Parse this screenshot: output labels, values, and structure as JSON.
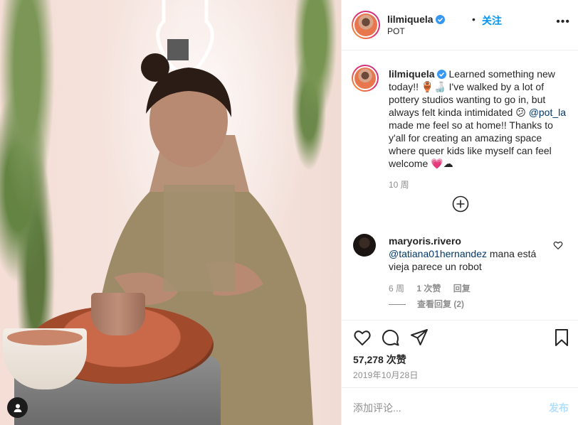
{
  "header": {
    "username": "lilmiquela",
    "dot": "•",
    "follow_label": "关注",
    "location": "POT",
    "more_label": "•••"
  },
  "caption": {
    "username": "lilmiquela",
    "text_1": "Learned something new today!! 🏺🍶 I've walked by a lot of pottery studios wanting to go in, but always felt kinda intimidated 😕 ",
    "mention": "@pot_la",
    "text_2": " made me feel so at home!! Thanks to y'all for creating an amazing space where queer kids like myself can feel welcome 💗☁",
    "time": "10 周"
  },
  "comment": {
    "username": "maryoris.rivero",
    "mention": "@tatiana01hernandez",
    "text": " mana está vieja parece un robot",
    "time": "6 周",
    "likes": "1 次赞",
    "reply_label": "回复",
    "view_replies": "查看回复 (2)"
  },
  "actions": {
    "likes": "57,278 次赞",
    "date": "2019年10月28日"
  },
  "comment_box": {
    "placeholder": "添加评论...",
    "post_label": "发布"
  },
  "colors": {
    "accent": "#0095f6",
    "post_disabled": "#b2dffc",
    "mention": "#00376b",
    "muted": "#8e8e8e"
  },
  "icons": [
    "verified-badge-icon",
    "more-icon",
    "add-circle-icon",
    "heart-icon",
    "comment-icon",
    "share-icon",
    "bookmark-icon",
    "user-icon"
  ]
}
